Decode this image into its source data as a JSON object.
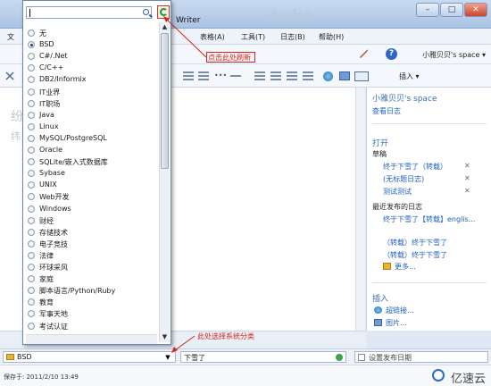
{
  "window": {
    "title": "Writer",
    "ghost_text": "Aabt"
  },
  "menu": {
    "items": [
      "文",
      "表格(A)",
      "工具(T)",
      "日志(B)",
      "帮助(H)"
    ]
  },
  "toolbar": {
    "account": "小雅贝贝's space ▾",
    "insert_label": "插入 ▾",
    "help_label": "?"
  },
  "editor": {
    "ghost_line1": "纷",
    "ghost_line2": "纬"
  },
  "side_panel": {
    "space_title": "小雅贝贝's space",
    "view_log": "查看日志",
    "open_heading": "打开",
    "drafts_label": "草稿",
    "drafts": [
      "终于下雪了（转载）",
      "(无标题日志)",
      "测试测试"
    ],
    "recent_label": "最近发布的日志",
    "recent": [
      "终于下雪了【转载】englis...",
      "（转载）终于下雪了",
      "（转载）终于下雪了"
    ],
    "more": "更多...",
    "insert_heading": "插入",
    "insert_items": [
      "超链接...",
      "图片..."
    ]
  },
  "category_popup": {
    "selected": "BSD",
    "options": [
      "无",
      "BSD",
      "C#/.Net",
      "C/C++",
      "DB2/Informix",
      "IT业界",
      "IT职场",
      "Java",
      "Linux",
      "MySQL/PostgreSQL",
      "Oracle",
      "SQLite/嵌入式数据库",
      "Sybase",
      "UNIX",
      "Web开发",
      "Windows",
      "财经",
      "存储技术",
      "电子竞技",
      "法律",
      "环球采风",
      "家庭",
      "脚本语言/Python/Ruby",
      "教育",
      "军事天地",
      "考试认证"
    ]
  },
  "statusbar": {
    "category_value": "BSD",
    "tags_value": "下雪了",
    "publish_date_label": "设置发布日期",
    "dropdown_glyph": "▼"
  },
  "footer": {
    "saved_text": "保存于: 2011/2/10 13:49",
    "brand": "亿速云"
  },
  "annotations": {
    "refresh_note": "点击此处刷新",
    "category_note": "此处选择系统分类"
  },
  "colors": {
    "annotation": "#d8231b",
    "link": "#1e5fc0",
    "heading": "#3a6fb4"
  }
}
